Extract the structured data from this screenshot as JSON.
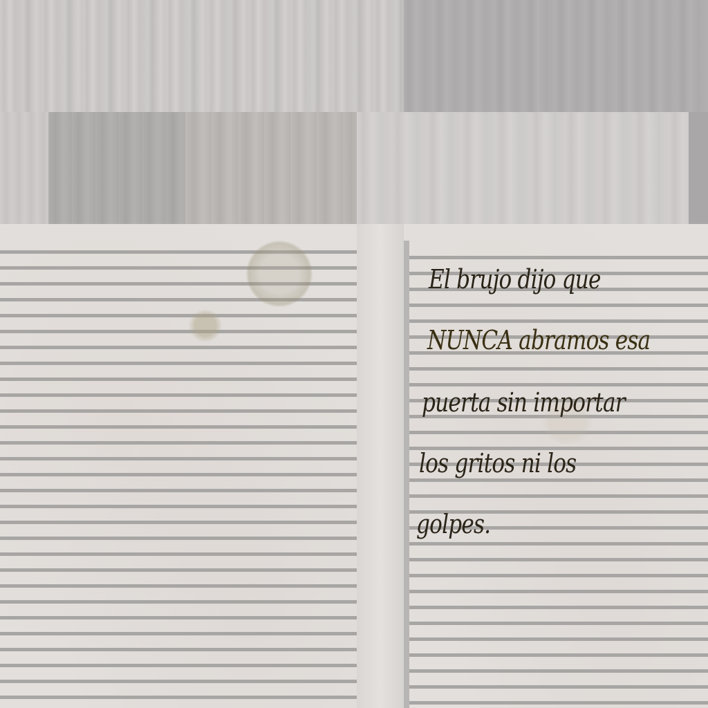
{
  "note": {
    "lines": [
      "El brujo dijo que",
      "NUNCA abramos esa",
      "puerta sin importar",
      "los gritos ni los",
      "golpes."
    ]
  },
  "colors": {
    "paper": "#e2dfdc",
    "rule_lines": "#a8a6a4",
    "ink": "#2a2418",
    "texture_gray": "#b0aeae"
  }
}
